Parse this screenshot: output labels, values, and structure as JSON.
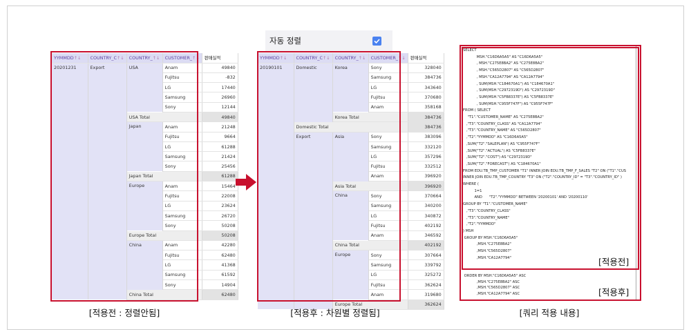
{
  "arrow_color": "#c8102e",
  "left_table": {
    "headers": [
      "YYMMDD",
      "COUNTRY_C",
      "COUNTRY_",
      "CUSTOMER_",
      "판매실적"
    ],
    "header_hints": [
      "↑↓",
      "↑↓",
      "↑↓",
      "↑↓",
      ""
    ],
    "yymmdd": "20201231",
    "class": "Export",
    "groups": [
      {
        "country": "USA",
        "rows": [
          [
            "Anam",
            "49840"
          ],
          [
            "Fujitsu",
            "-832"
          ],
          [
            "LG",
            "17440"
          ],
          [
            "Samsung",
            "26960"
          ],
          [
            "Sony",
            "12144"
          ]
        ],
        "total_label": "USA Total",
        "total": "49840"
      },
      {
        "country": "Japan",
        "rows": [
          [
            "Anam",
            "21248"
          ],
          [
            "Fujitsu",
            "9664"
          ],
          [
            "LG",
            "61288"
          ],
          [
            "Samsung",
            "21424"
          ],
          [
            "Sony",
            "25456"
          ]
        ],
        "total_label": "Japan Total",
        "total": "61288"
      },
      {
        "country": "Europe",
        "rows": [
          [
            "Anam",
            "15464"
          ],
          [
            "Fujitsu",
            "22008"
          ],
          [
            "LG",
            "23624"
          ],
          [
            "Samsung",
            "26720"
          ],
          [
            "Sony",
            "50208"
          ]
        ],
        "total_label": "Europe Total",
        "total": "50208"
      },
      {
        "country": "China",
        "rows": [
          [
            "Anam",
            "42280"
          ],
          [
            "Fujitsu",
            "62480"
          ],
          [
            "LG",
            "41368"
          ],
          [
            "Samsung",
            "61592"
          ],
          [
            "Sony",
            "14904"
          ]
        ],
        "total_label": "China Total",
        "total": "62480"
      }
    ],
    "caption": "[적용전 : 정렬안됨]"
  },
  "middle_table": {
    "sort_label": "자동 정렬",
    "sort_checked": true,
    "headers": [
      "YYMMDD",
      "COUNTRY_C",
      "COUNTRY_",
      "CUSTOMER_",
      "판매실적"
    ],
    "header_hints": [
      "↑↓",
      "↑↓",
      "↑↓",
      "↑↓",
      ""
    ],
    "yymmdd": "20190101",
    "domestic": {
      "class": "Domestic",
      "country": "Korea",
      "rows": [
        [
          "Sony",
          "328040"
        ],
        [
          "Samsung",
          "384736"
        ],
        [
          "LG",
          "343640"
        ],
        [
          "Fujitsu",
          "370680"
        ],
        [
          "Anam",
          "358168"
        ]
      ],
      "country_total_label": "Korea Total",
      "country_total": "384736",
      "class_total_label": "Domestic Total",
      "class_total": "384736"
    },
    "export": {
      "class": "Export",
      "groups": [
        {
          "country": "Asia",
          "rows": [
            [
              "Sony",
              "383096"
            ],
            [
              "Samsung",
              "332120"
            ],
            [
              "LG",
              "357296"
            ],
            [
              "Fujitsu",
              "332512"
            ],
            [
              "Anam",
              "396920"
            ]
          ],
          "total_label": "Asia Total",
          "total": "396920"
        },
        {
          "country": "China",
          "rows": [
            [
              "Sony",
              "370664"
            ],
            [
              "Samsung",
              "340200"
            ],
            [
              "LG",
              "340872"
            ],
            [
              "Fujitsu",
              "402192"
            ],
            [
              "Anam",
              "346592"
            ]
          ],
          "total_label": "China Total",
          "total": "402192"
        },
        {
          "country": "Europe",
          "rows": [
            [
              "Sony",
              "307664"
            ],
            [
              "Samsung",
              "339792"
            ],
            [
              "LG",
              "325272"
            ],
            [
              "Fujitsu",
              "362624"
            ],
            [
              "Anam",
              "319680"
            ]
          ],
          "total_label": "Europe Total",
          "total": "362624"
        }
      ]
    },
    "caption": "[적용후 : 차원별 정렬됨]"
  },
  "query": {
    "lines_top": [
      "SELECT",
      "            MSH.\"C16D6A5A5\" AS \"C16D6A5A5\"",
      "            , MSH.\"C275E8BA2\" AS \"C275E8BA2\"",
      "            , MSH.\"C565D2807\" AS \"C565D2807\"",
      "            , MSH.\"CA12A7794\" AS \"CA12A7794\"",
      "            , SUM(MSH.\"C184670A1\") AS \"C184670A1\"",
      "            , SUM(MSH.\"C2972319D\") AS \"C2972319D\"",
      "            , SUM(MSH.\"C5FB8337E\") AS \"C5FB8337E\"",
      "            , SUM(MSH.\"C955F747F\") AS \"C955F747F\"",
      "FROM ( SELECT",
      "    \"T1\".\"CUSTOMER_NAME\" AS \"C275E8BA2\"",
      "   ,\"T3\".\"COUNTRY_CLASS\" AS \"CA12A7794\"",
      "   ,\"T3\".\"COUNTRY_NAME\" AS \"C565D2807\"",
      "   ,\"T2\".\"YYMMDD\" AS \"C16D6A5A5\"",
      "   ,SUM(\"T2\".\"SALEPLAN\") AS \"C955F747F\"",
      "   ,SUM(\"T2\".\"ACTUAL\") AS \"C5FB8337E\"",
      "   ,SUM(\"T2\".\"COST\") AS \"C2972319D\"",
      "   ,SUM(\"T2\".\"FORECAST\") AS \"C184670A1\"",
      "FROM EDU.TB_TMP_CUSTOMER \"T1\" INNER JOIN EDU.TB_TMP_F_SALES \"T2\" ON (\"T1\".\"CUS",
      "INNER JOIN EDU.TB_TMP_COUNTRY \"T3\" ON (\"T2\".\"COUNTRY_ID\" = \"T3\".\"COUNTRY_ID\" )",
      "WHERE (",
      "          1=1",
      "          AND      \"T2\".\"YYMMDD\" BETWEEN '20200101' AND '20200110'",
      "",
      "GROUP BY \"T1\".\"CUSTOMER_NAME\"",
      "   ,\"T3\".\"COUNTRY_CLASS\"",
      "   ,\"T3\".\"COUNTRY_NAME\"",
      "   ,\"T2\".\"YYMMDD\"",
      ") MSH",
      " GROUP BY MSH.\"C16D6A5A5\"",
      "            ,MSH.\"C275E8BA2\"",
      "            ,MSH.\"C565D2807\"",
      "            ,MSH.\"CA12A7794\""
    ],
    "lines_bottom": [
      " ORDER BY MSH.\"C16D6A5A5\" ASC",
      "            ,MSH.\"C275E8BA2\" ASC",
      "            ,MSH.\"C565D2807\" ASC",
      "            ,MSH.\"CA12A7794\" ASC"
    ],
    "tag_before": "[적용전]",
    "tag_after": "[적용후]",
    "caption": "[쿼리 적용 내용]"
  }
}
